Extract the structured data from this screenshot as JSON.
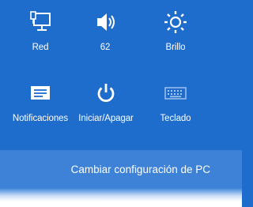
{
  "quick_settings": {
    "network": {
      "label": "Red",
      "icon": "network-icon"
    },
    "volume": {
      "label": "62",
      "icon": "speaker-icon"
    },
    "brightness": {
      "label": "Brillo",
      "icon": "sun-icon"
    },
    "notifications": {
      "label": "Notificaciones",
      "icon": "notifications-icon"
    },
    "power": {
      "label": "Iniciar/Apagar",
      "icon": "power-icon"
    },
    "keyboard": {
      "label": "Teclado",
      "icon": "keyboard-icon"
    }
  },
  "change_settings": {
    "label": "Cambiar configuración de PC"
  },
  "colors": {
    "background": "#1e6ccc",
    "band": "#3d82d6",
    "foreground": "#ffffff"
  }
}
